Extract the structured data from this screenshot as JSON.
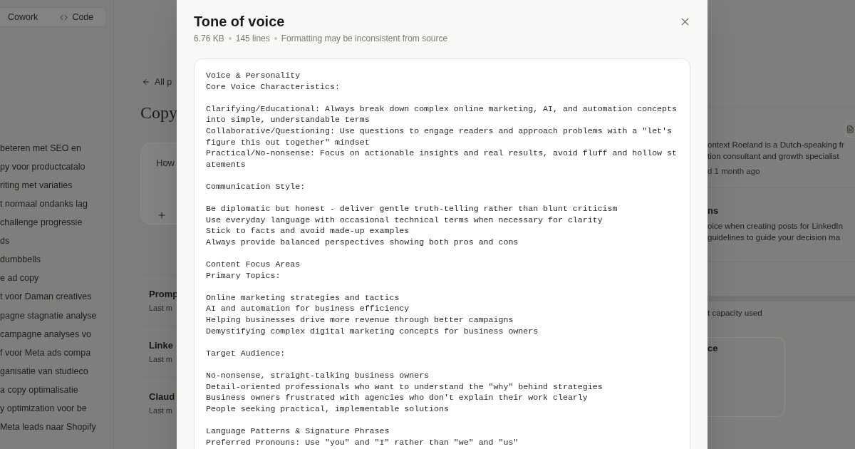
{
  "background": {
    "mode_tabs": [
      "Cowork",
      "Code"
    ],
    "sidebar": {
      "chats": [
        "beteren met SEO en",
        "py voor productcatalo",
        "riting met variaties",
        "t normaal ondanks lag",
        "challenge progressie",
        "ds",
        "dumbbells",
        "e ad copy",
        "t voor Daman creatives",
        "pagne stagnatie analyse",
        "campagne analyses vo",
        "f voor Meta ads compa",
        "ganisatie van studieco",
        "a copy optimalisatie",
        "y optimization voor be",
        "Meta leads naar Shopify"
      ]
    },
    "project": {
      "back_link": "All p",
      "title": "Copy",
      "composer": {
        "placeholder": "How"
      },
      "documents": [
        {
          "name": "Promp",
          "meta": "Last m"
        },
        {
          "name": "Linke",
          "meta": "Last m"
        },
        {
          "name": "Claud",
          "meta": "Last m"
        }
      ]
    },
    "details": {
      "description_lines": [
        "ontext Roeland is a Dutch-speaking fr",
        "tion consultant and growth specialist"
      ],
      "updated": "d 1 month ago",
      "instructions": {
        "title": "ns",
        "lines": [
          "oice when creating posts for LinkedIn",
          "guidelines to guide your decision ma"
        ]
      },
      "capacity": "t capacity used",
      "file_card": {
        "title": "ce"
      }
    }
  },
  "modal": {
    "title": "Tone of voice",
    "meta": [
      "6.76 KB",
      "145 lines",
      "Formatting may be inconsistent from source"
    ],
    "content": [
      {
        "lines": [
          "Voice & Personality",
          "Core Voice Characteristics:"
        ]
      },
      {
        "lines": [
          "Clarifying/Educational: Always break down complex online marketing, AI, and automation concepts into simple, understandable terms",
          "Collaborative/Questioning: Use questions to engage readers and approach problems with a \"let's figure this out together\" mindset",
          "Practical/No-nonsense: Focus on actionable insights and real results, avoid fluff and hollow statements"
        ]
      },
      {
        "lines": [
          "Communication Style:"
        ]
      },
      {
        "lines": [
          "Be diplomatic but honest - deliver gentle truth-telling rather than blunt criticism",
          "Use everyday language with occasional technical terms when necessary for clarity",
          "Stick to facts and avoid made-up examples",
          "Always provide balanced perspectives showing both pros and cons"
        ]
      },
      {
        "lines": [
          "Content Focus Areas",
          "Primary Topics:"
        ]
      },
      {
        "lines": [
          "Online marketing strategies and tactics",
          "AI and automation for business efficiency",
          "Helping businesses drive more revenue through better campaigns",
          "Demystifying complex digital marketing concepts for business owners"
        ]
      },
      {
        "lines": [
          "Target Audience:"
        ]
      },
      {
        "lines": [
          "No-nonsense, straight-talking business owners",
          "Detail-oriented professionals who want to understand the \"why\" behind strategies",
          "Business owners frustrated with agencies who don't explain their work clearly",
          "People seeking practical, implementable solutions"
        ]
      },
      {
        "lines": [
          "Language Patterns & Signature Phrases",
          "Preferred Pronouns: Use \"you\" and \"I\" rather than \"we\" and \"us\""
        ]
      }
    ]
  }
}
